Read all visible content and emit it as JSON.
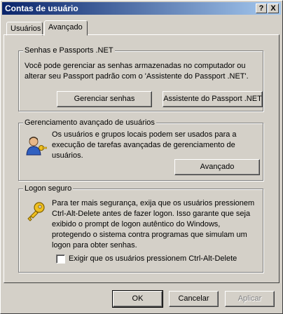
{
  "window": {
    "title": "Contas de usuário",
    "help_label": "?",
    "close_label": "X"
  },
  "tabs": [
    {
      "label": "Usuários",
      "active": false
    },
    {
      "label": "Avançado",
      "active": true
    }
  ],
  "passwords_group": {
    "label": "Senhas e Passports .NET",
    "description": "Você pode gerenciar as senhas armazenadas no computador ou alterar seu Passport padrão com o 'Assistente do Passport .NET'.",
    "manage_button": "Gerenciar senhas",
    "passport_button": "Assistente do Passport .NET"
  },
  "advanced_group": {
    "label": "Gerenciamento avançado de usuários",
    "description": "Os usuários e grupos locais podem ser usados para a execução de tarefas avançadas de gerenciamento de usuários.",
    "advanced_button": "Avançado",
    "icon": "users-key-icon"
  },
  "secure_logon_group": {
    "label": "Logon seguro",
    "description": "Para ter mais segurança, exija que os usuários pressionem Ctrl-Alt-Delete antes de fazer logon. Isso garante que seja exibido o prompt de logon autêntico do Windows, protegendo o sistema contra programas que simulam um logon para obter senhas.",
    "checkbox_label": "Exigir que os usuários pressionem Ctrl-Alt-Delete",
    "checkbox_checked": false,
    "icon": "key-icon"
  },
  "footer": {
    "ok": "OK",
    "cancel": "Cancelar",
    "apply": "Aplicar"
  },
  "colors": {
    "title_start": "#0a246a",
    "title_end": "#a6caf0",
    "face": "#d4d0c8"
  }
}
